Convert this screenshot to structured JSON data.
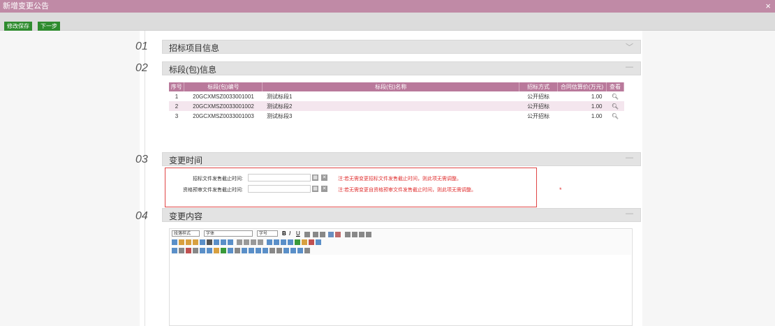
{
  "window": {
    "title": "新增变更公告",
    "close": "×"
  },
  "toolbar": {
    "save_label": "修改保存",
    "next_label": "下一步"
  },
  "sections": [
    {
      "num": "01",
      "title": "招标项目信息",
      "toggle": "﹀"
    },
    {
      "num": "02",
      "title": "标段(包)信息",
      "toggle": "—"
    },
    {
      "num": "03",
      "title": "变更时间",
      "toggle": "—"
    },
    {
      "num": "04",
      "title": "变更内容",
      "toggle": "—"
    }
  ],
  "bid_table": {
    "headers": [
      "序号",
      "标段(包)编号",
      "标段(包)名称",
      "招标方式",
      "合同估算价(万元)",
      "查看"
    ],
    "rows": [
      {
        "idx": "1",
        "code": "20GCXMSZ0033001001",
        "name": "测试标段1",
        "method": "公开招标",
        "price": "1.00"
      },
      {
        "idx": "2",
        "code": "20GCXMSZ0033001002",
        "name": "测试标段2",
        "method": "公开招标",
        "price": "1.00"
      },
      {
        "idx": "3",
        "code": "20GCXMSZ0033001003",
        "name": "测试标段3",
        "method": "公开招标",
        "price": "1.00"
      }
    ]
  },
  "change_time": {
    "field1_label": "招标文件发售截止时间:",
    "field2_label": "资格预审文件发售截止时间:",
    "note1": "注:若无需变更招标文件发售截止时间，则此项无需调整。",
    "note2": "注:若无需变更自资格预审文件发售截止时间，则此项无需调整。",
    "required_mark": "*"
  },
  "editor": {
    "paragraph_format": "段落样式",
    "font_family": "字体",
    "font_size": "字号"
  },
  "colors": {
    "titlebar": "#c08aa6",
    "table_header": "#b9799b",
    "button": "#2e8b2e",
    "note": "#e03030"
  }
}
